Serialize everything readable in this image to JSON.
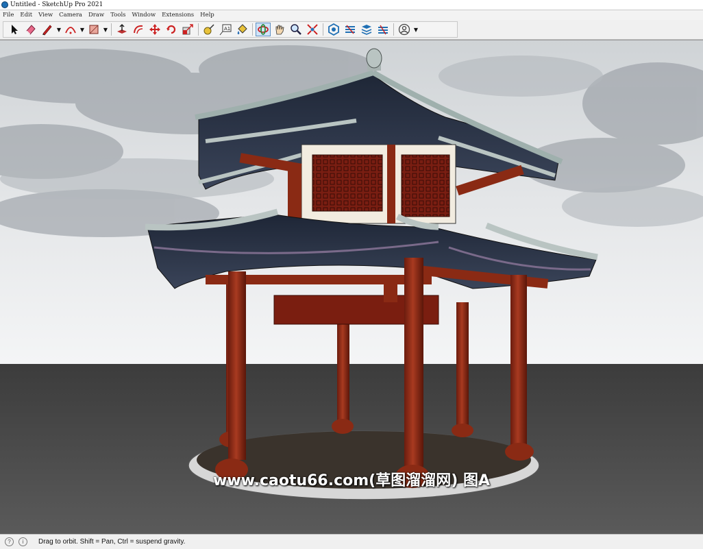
{
  "window": {
    "title": "Untitled - SketchUp Pro 2021"
  },
  "menu": {
    "items": [
      "File",
      "Edit",
      "View",
      "Camera",
      "Draw",
      "Tools",
      "Window",
      "Extensions",
      "Help"
    ]
  },
  "toolbar": {
    "buttons": [
      {
        "name": "select-tool-icon"
      },
      {
        "name": "eraser-tool-icon"
      },
      {
        "name": "pencil-line-tool-icon"
      },
      {
        "name": "arc-tool-icon"
      },
      {
        "name": "rectangle-tool-icon"
      },
      {
        "name": "push-pull-tool-icon"
      },
      {
        "name": "offset-tool-icon"
      },
      {
        "name": "move-tool-icon"
      },
      {
        "name": "rotate-tool-icon"
      },
      {
        "name": "scale-tool-icon"
      },
      {
        "name": "tape-measure-tool-icon"
      },
      {
        "name": "text-tool-icon"
      },
      {
        "name": "paint-bucket-tool-icon"
      },
      {
        "name": "orbit-tool-icon",
        "active": true
      },
      {
        "name": "pan-tool-icon"
      },
      {
        "name": "zoom-tool-icon"
      },
      {
        "name": "zoom-extents-tool-icon"
      },
      {
        "name": "3d-warehouse-icon"
      },
      {
        "name": "extension-warehouse-icon"
      },
      {
        "name": "layout-icon"
      },
      {
        "name": "extension-manager-icon"
      },
      {
        "name": "user-account-icon"
      }
    ]
  },
  "viewport": {
    "scene": "Chinese pavilion 3D model",
    "watermark": "www.caotu66.com(草图溜溜网) 图A"
  },
  "status": {
    "text": "Drag to orbit. Shift = Pan, Ctrl = suspend gravity."
  }
}
